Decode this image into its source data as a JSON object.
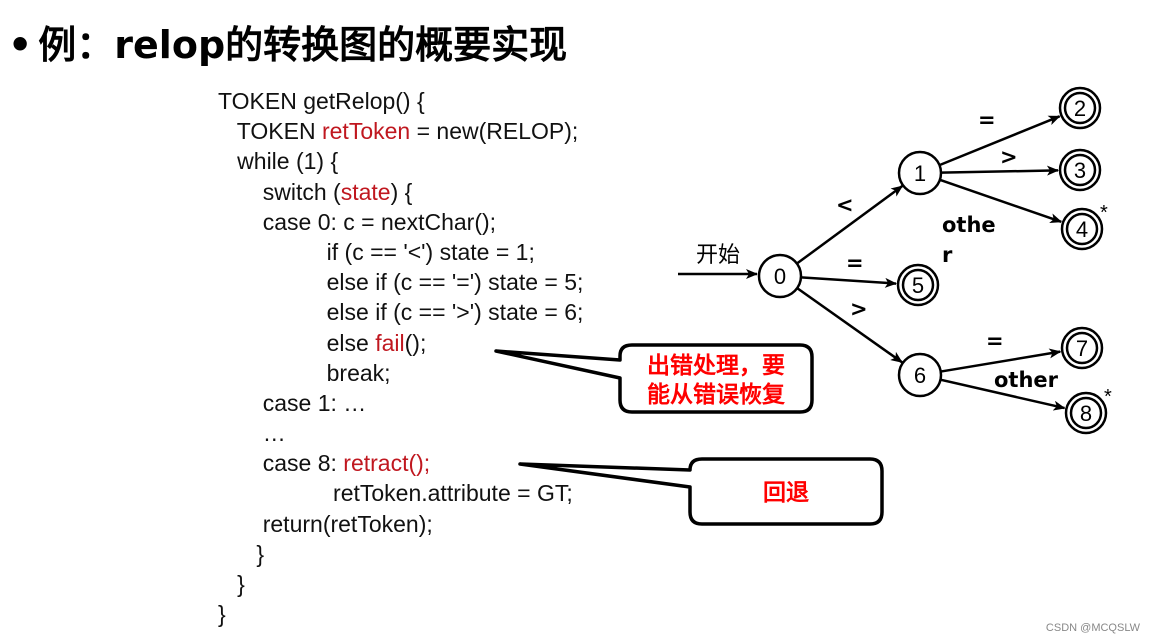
{
  "slide": {
    "bullet": "•",
    "title": "例：relop的转换图的概要实现"
  },
  "code": {
    "lines": [
      {
        "indent": "",
        "parts": [
          {
            "t": "TOKEN getRelop() {",
            "red": false
          }
        ]
      },
      {
        "indent": "   ",
        "parts": [
          {
            "t": "TOKEN ",
            "red": false
          },
          {
            "t": "retToken",
            "red": true
          },
          {
            "t": " = new(RELOP);",
            "red": false
          }
        ]
      },
      {
        "indent": "   ",
        "parts": [
          {
            "t": "while (1) {",
            "red": false
          }
        ]
      },
      {
        "indent": "       ",
        "parts": [
          {
            "t": "switch (",
            "red": false
          },
          {
            "t": "state",
            "red": true
          },
          {
            "t": ") {",
            "red": false
          }
        ]
      },
      {
        "indent": "       ",
        "parts": [
          {
            "t": "case 0: c = nextChar();",
            "red": false
          }
        ]
      },
      {
        "indent": "                 ",
        "parts": [
          {
            "t": "if (c == '<') state = 1;",
            "red": false
          }
        ]
      },
      {
        "indent": "                 ",
        "parts": [
          {
            "t": "else if (c == '=') state = 5;",
            "red": false
          }
        ]
      },
      {
        "indent": "                 ",
        "parts": [
          {
            "t": "else if (c == '>') state = 6;",
            "red": false
          }
        ]
      },
      {
        "indent": "                 ",
        "parts": [
          {
            "t": "else ",
            "red": false
          },
          {
            "t": "fail",
            "red": true
          },
          {
            "t": "();",
            "red": false
          }
        ]
      },
      {
        "indent": "                 ",
        "parts": [
          {
            "t": "break;",
            "red": false
          }
        ]
      },
      {
        "indent": "       ",
        "parts": [
          {
            "t": "case 1: …",
            "red": false
          }
        ]
      },
      {
        "indent": "       ",
        "parts": [
          {
            "t": "…",
            "red": false
          }
        ]
      },
      {
        "indent": "       ",
        "parts": [
          {
            "t": "case 8: ",
            "red": false
          },
          {
            "t": "retract();",
            "red": true
          }
        ]
      },
      {
        "indent": "                  ",
        "parts": [
          {
            "t": "retToken.attribute = GT;",
            "red": false
          }
        ]
      },
      {
        "indent": "       ",
        "parts": [
          {
            "t": "return(retToken);",
            "red": false
          }
        ]
      },
      {
        "indent": "      ",
        "parts": [
          {
            "t": "}",
            "red": false
          }
        ]
      },
      {
        "indent": "   ",
        "parts": [
          {
            "t": "}",
            "red": false
          }
        ]
      },
      {
        "indent": "",
        "parts": [
          {
            "t": "}",
            "red": false
          }
        ]
      }
    ]
  },
  "callouts": {
    "error": {
      "line1": "出错处理，要",
      "line2": "能从错误恢复"
    },
    "retract": {
      "text": "回退"
    }
  },
  "diagram": {
    "start_label": "开始",
    "states": [
      {
        "id": "0",
        "accepting": false,
        "star": false
      },
      {
        "id": "1",
        "accepting": false,
        "star": false
      },
      {
        "id": "2",
        "accepting": true,
        "star": false
      },
      {
        "id": "3",
        "accepting": true,
        "star": false
      },
      {
        "id": "4",
        "accepting": true,
        "star": true
      },
      {
        "id": "5",
        "accepting": true,
        "star": false
      },
      {
        "id": "6",
        "accepting": false,
        "star": false
      },
      {
        "id": "7",
        "accepting": true,
        "star": false
      },
      {
        "id": "8",
        "accepting": true,
        "star": true
      }
    ],
    "transitions": [
      {
        "from": "0",
        "to": "1",
        "label": "<"
      },
      {
        "from": "0",
        "to": "5",
        "label": "="
      },
      {
        "from": "0",
        "to": "6",
        "label": ">"
      },
      {
        "from": "1",
        "to": "2",
        "label": "="
      },
      {
        "from": "1",
        "to": "3",
        "label": ">"
      },
      {
        "from": "1",
        "to": "4",
        "label_line1": "othe",
        "label_line2": "r"
      },
      {
        "from": "6",
        "to": "7",
        "label": "="
      },
      {
        "from": "6",
        "to": "8",
        "label": "other"
      }
    ],
    "star_symbol": "*"
  },
  "watermark": "CSDN @MCQSLW"
}
